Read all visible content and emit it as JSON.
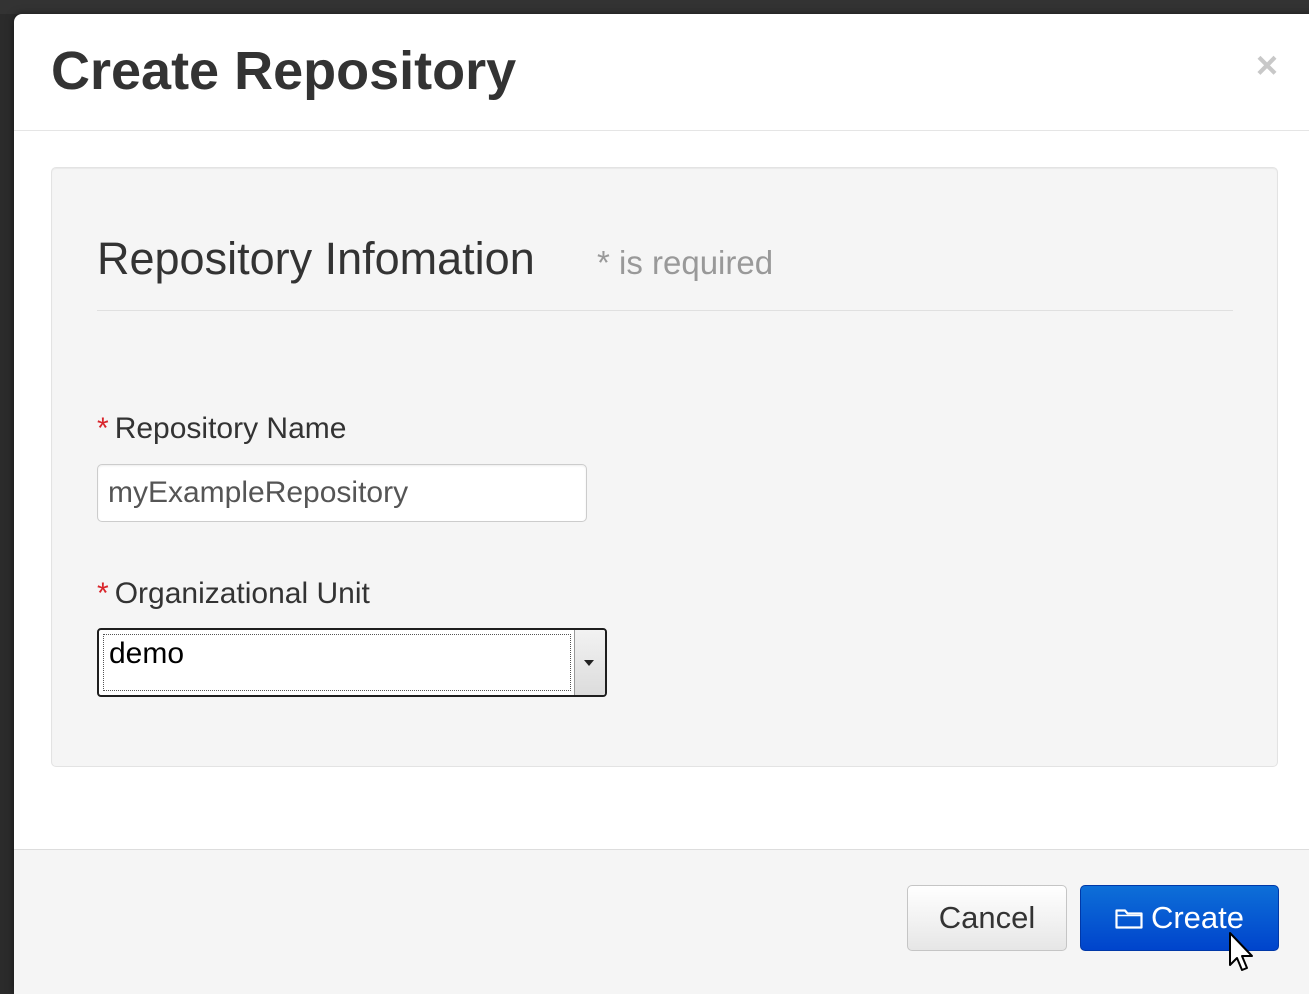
{
  "modal": {
    "title": "Create Repository",
    "close_label": "×"
  },
  "form": {
    "section_title": "Repository Infomation",
    "required_hint": "* is required",
    "required_marker": "*",
    "repository_name": {
      "label": "Repository Name",
      "value": "myExampleRepository"
    },
    "organizational_unit": {
      "label": "Organizational Unit",
      "selected": "demo"
    }
  },
  "footer": {
    "cancel_label": "Cancel",
    "create_label": "Create"
  },
  "colors": {
    "primary_button": "#0044cc",
    "required_marker": "#d9252b",
    "title_text": "#333333"
  },
  "icons": {
    "close": "close-icon",
    "create": "folder-icon",
    "select_arrow": "chevron-down-icon",
    "pointer": "mouse-cursor-icon"
  }
}
